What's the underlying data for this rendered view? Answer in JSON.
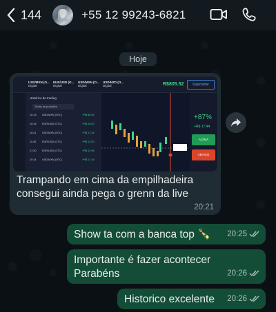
{
  "header": {
    "back_count": "144",
    "contact": "+55 12 99243-6821"
  },
  "date_chip": "Hoje",
  "incoming": {
    "caption_lines": [
      "Trampando em cima da empilhadeira",
      "consegui ainda pega o grenn da live"
    ],
    "time": "20:21",
    "screenshot": {
      "tabs": [
        {
          "pair": "USD/MXN (O...",
          "sub": "Digital"
        },
        {
          "pair": "EUR/USD (O...",
          "sub": "Digital"
        },
        {
          "pair": "USD/MXN (O...",
          "sub": "Digital"
        },
        {
          "pair": "USD/NZD (O...",
          "sub": "Digital"
        }
      ],
      "balance": "R$805.52",
      "deposit": "Depositar",
      "history_title": "Histórico de trading",
      "filter": "Todas as posições",
      "rows": [
        {
          "t": "10:13",
          "asset": "USD/MXN (OTC)",
          "v": "+R$ 56.94"
        },
        {
          "t": "10:15",
          "asset": "EUR/USD (OTC)",
          "v": "+R$ 15.00"
        },
        {
          "t": "10:21",
          "asset": "USD/MXN (OTC)",
          "v": "+R$ 17.44"
        },
        {
          "t": "11:30",
          "asset": "EUR/USD (OTC)",
          "v": "+R$ 12.00"
        },
        {
          "t": "21:30",
          "asset": "EUR/USD (OTC)",
          "v": "+R$ 13.96"
        },
        {
          "t": "10:14",
          "asset": "USD/MXN (OTC)",
          "v": "+R$ 17.44"
        }
      ],
      "payout_pct": "+87%",
      "payout_value": "+R$ 17.44",
      "up_label": "ACIMA",
      "down_label": "ABAIXO"
    }
  },
  "outgoing": [
    {
      "lines": [
        "Show ta com a banca top 🍾"
      ],
      "time": "20:25"
    },
    {
      "lines": [
        "Importante é fazer acontecer",
        "Parabéns"
      ],
      "time": "20:26"
    },
    {
      "lines": [
        "Historico excelente"
      ],
      "time": "20:26"
    }
  ],
  "colors": {
    "background": "#0b1014",
    "incoming_bubble": "#1f2c33",
    "outgoing_bubble": "#144d37",
    "read_tick": "#a9c4b8"
  }
}
